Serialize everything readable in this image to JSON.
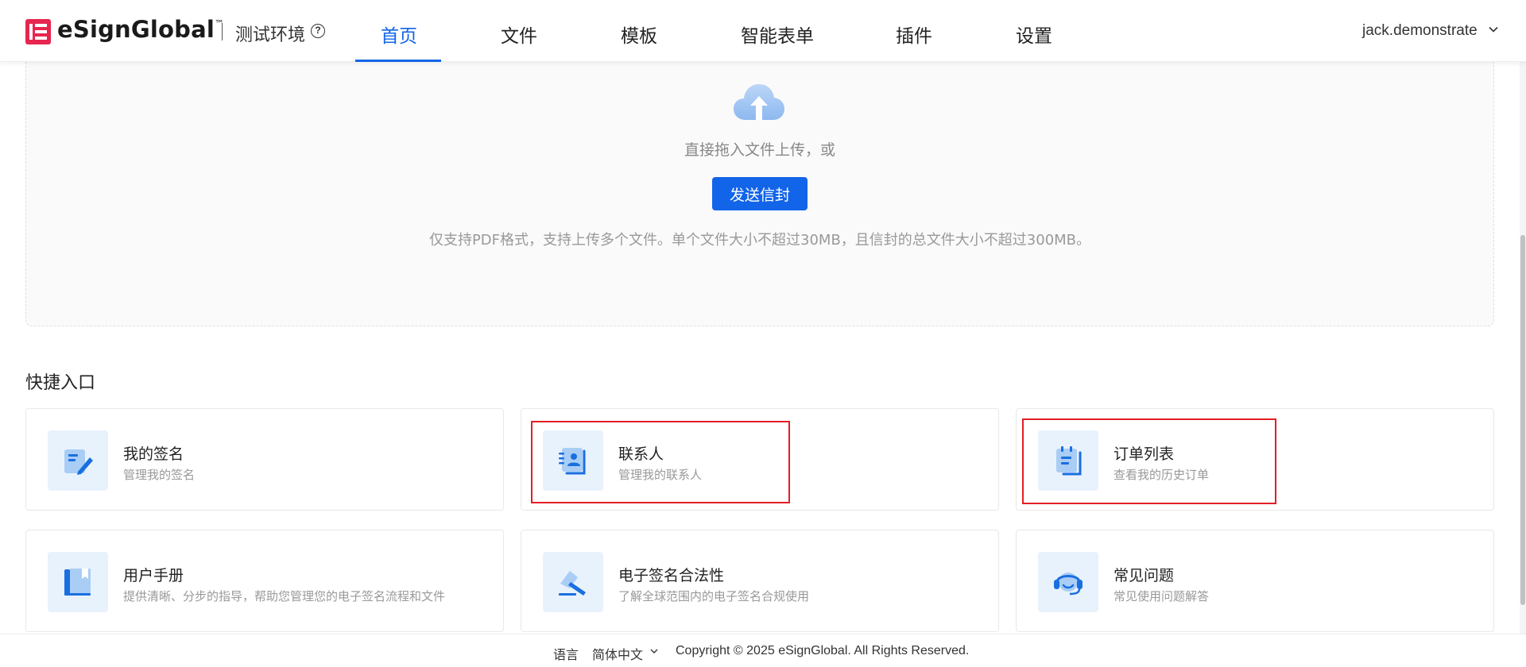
{
  "header": {
    "brand": "eSignGlobal",
    "brand_tm": "™",
    "environment": "测试环境",
    "help_glyph": "?",
    "nav": [
      {
        "label": "首页",
        "active": true
      },
      {
        "label": "文件",
        "active": false
      },
      {
        "label": "模板",
        "active": false
      },
      {
        "label": "智能表单",
        "active": false
      },
      {
        "label": "插件",
        "active": false
      },
      {
        "label": "设置",
        "active": false
      }
    ],
    "user": "jack.demonstrate"
  },
  "upload": {
    "hint": "直接拖入文件上传，或",
    "button": "发送信封",
    "note": "仅支持PDF格式，支持上传多个文件。单个文件大小不超过30MB，且信封的总文件大小不超过300MB。"
  },
  "quick_entry": {
    "title": "快捷入口",
    "cards": [
      {
        "title": "我的签名",
        "desc": "管理我的签名",
        "icon": "signature-icon"
      },
      {
        "title": "联系人",
        "desc": "管理我的联系人",
        "icon": "contacts-icon"
      },
      {
        "title": "订单列表",
        "desc": "查看我的历史订单",
        "icon": "order-list-icon"
      },
      {
        "title": "用户手册",
        "desc": "提供清晰、分步的指导，帮助您管理您的电子签名流程和文件",
        "icon": "manual-icon"
      },
      {
        "title": "电子签名合法性",
        "desc": "了解全球范围内的电子签名合规使用",
        "icon": "gavel-icon"
      },
      {
        "title": "常见问题",
        "desc": "常见使用问题解答",
        "icon": "headset-icon"
      }
    ]
  },
  "footer": {
    "language_label": "语言",
    "language_value": "简体中文",
    "copyright": "Copyright © 2025 eSignGlobal. All Rights Reserved."
  },
  "colors": {
    "primary": "#1264e8",
    "brand_red": "#e6264f",
    "highlight_red": "#e31e24",
    "icon_bg": "#e8f2fd"
  }
}
